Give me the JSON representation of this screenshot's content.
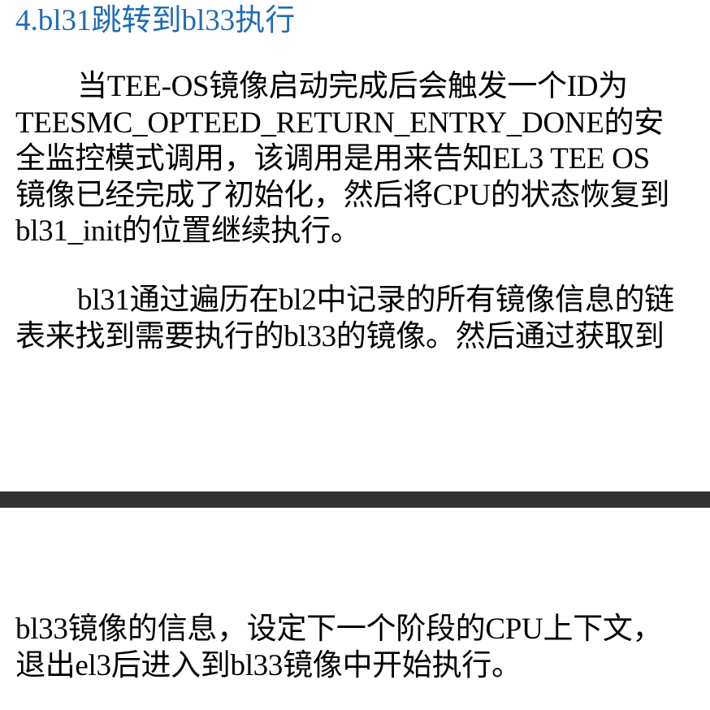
{
  "page1": {
    "heading": "4.bl31跳转到bl33执行",
    "paragraph1": [
      "当TEE-OS镜像启动完成后会触发一个ID为",
      "TEESMC_OPTEED_RETURN_ENTRY_DONE的安",
      "全监控模式调用，该调用是用来告知EL3 TEE OS",
      "镜像已经完成了初始化，然后将CPU的状态恢复到",
      "bl31_init的位置继续执行。"
    ],
    "paragraph2": [
      "bl31通过遍历在bl2中记录的所有镜像信息的链",
      "表来找到需要执行的bl33的镜像。然后通过获取到"
    ]
  },
  "page2": {
    "paragraph": [
      "bl33镜像的信息，设定下一个阶段的CPU上下文，",
      "退出el3后进入到bl33镜像中开始执行。"
    ]
  },
  "colors": {
    "heading": "#1f6cb5",
    "separator": "#333333",
    "text": "#000000",
    "background": "#ffffff"
  }
}
